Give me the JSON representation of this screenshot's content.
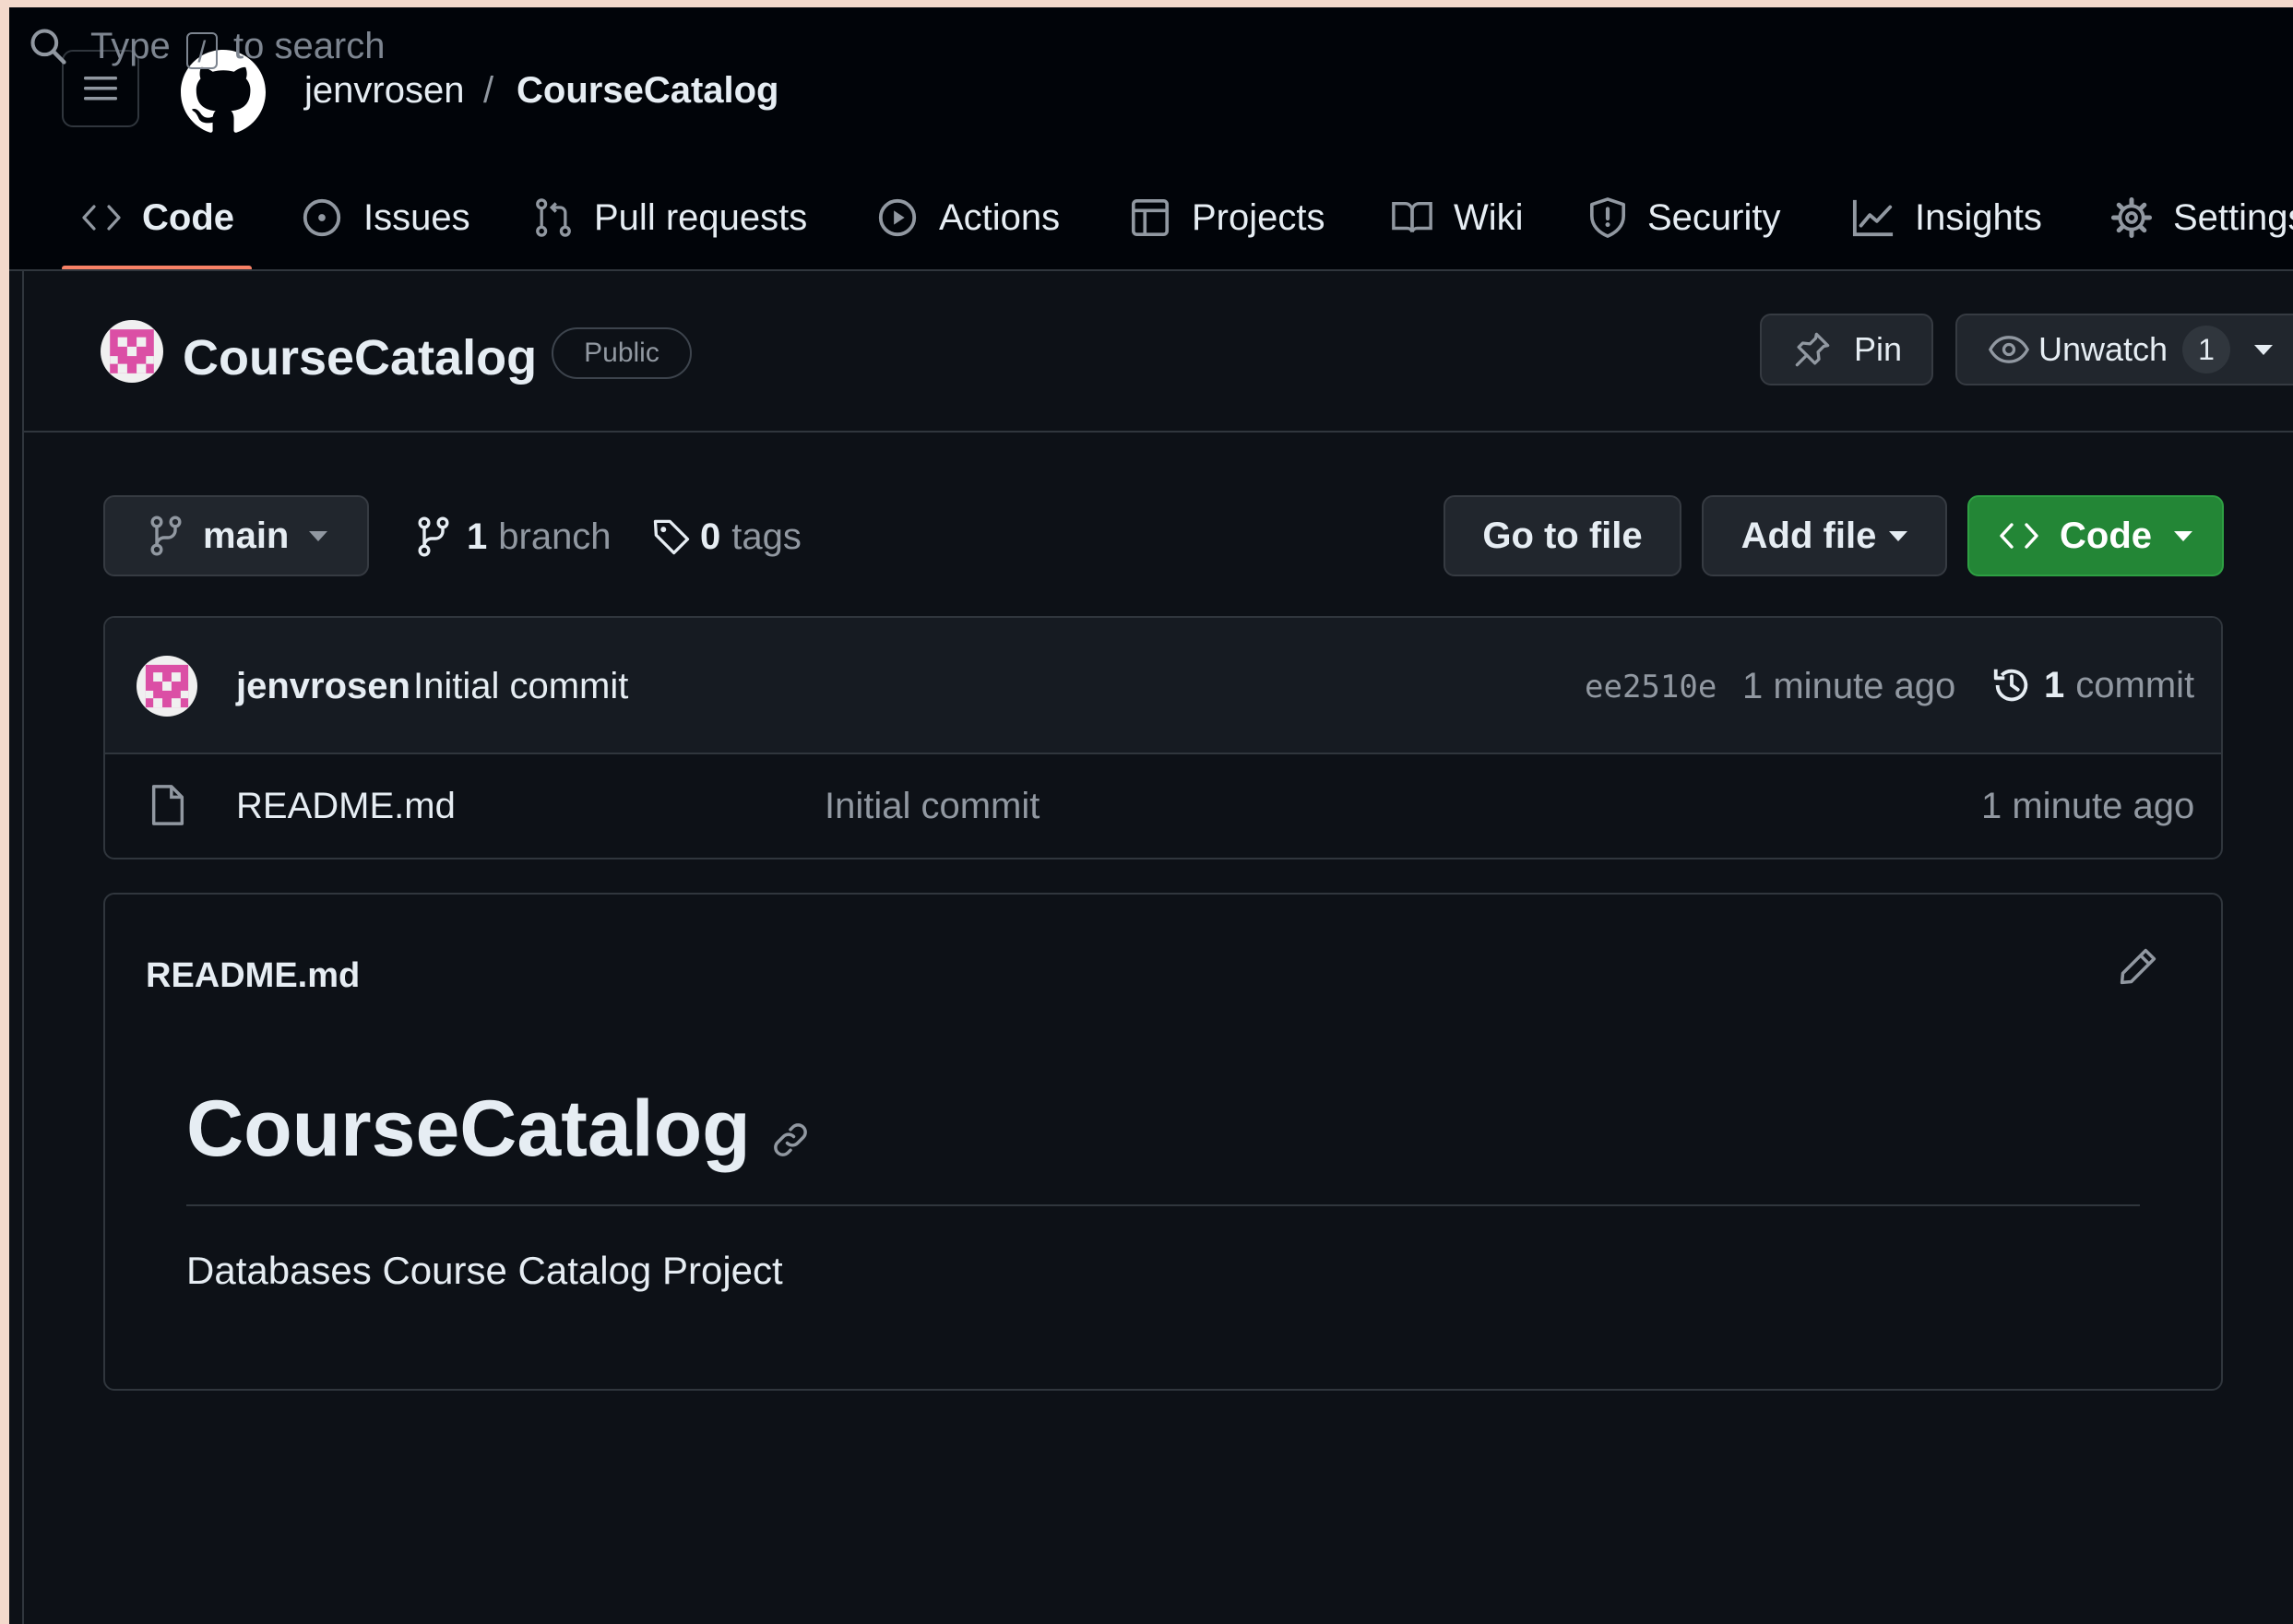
{
  "header": {
    "owner": "jenvrosen",
    "separator": "/",
    "repo": "CourseCatalog",
    "search_before": "Type",
    "search_key": "/",
    "search_after": "to search"
  },
  "tabs": [
    {
      "label": "Code",
      "icon": "code-icon",
      "active": true
    },
    {
      "label": "Issues",
      "icon": "issue-opened-icon"
    },
    {
      "label": "Pull requests",
      "icon": "git-pull-request-icon"
    },
    {
      "label": "Actions",
      "icon": "play-icon"
    },
    {
      "label": "Projects",
      "icon": "table-icon"
    },
    {
      "label": "Wiki",
      "icon": "book-icon"
    },
    {
      "label": "Security",
      "icon": "shield-icon"
    },
    {
      "label": "Insights",
      "icon": "graph-icon"
    },
    {
      "label": "Settings",
      "icon": "gear-icon"
    }
  ],
  "repo_bar": {
    "name": "CourseCatalog",
    "visibility": "Public",
    "pin_label": "Pin",
    "unwatch_label": "Unwatch",
    "watch_count": "1"
  },
  "toolbar": {
    "branch": "main",
    "branch_count": "1",
    "branch_word": "branch",
    "tag_count": "0",
    "tag_word": "tags",
    "go_to_file": "Go to file",
    "add_file": "Add file",
    "code_button": "Code"
  },
  "latest_commit": {
    "author": "jenvrosen",
    "message": "Initial commit",
    "sha": "ee2510e",
    "time": "1 minute ago",
    "commit_count": "1",
    "commit_word": "commit"
  },
  "files": [
    {
      "name": "README.md",
      "message": "Initial commit",
      "time": "1 minute ago"
    }
  ],
  "readme": {
    "filename": "README.md",
    "heading": "CourseCatalog",
    "body": "Databases Course Catalog Project"
  },
  "colors": {
    "background": "#0d1117",
    "header": "#010409",
    "accent_underline": "#f78166",
    "green_button": "#238636",
    "avatar": "#db4fa5"
  }
}
